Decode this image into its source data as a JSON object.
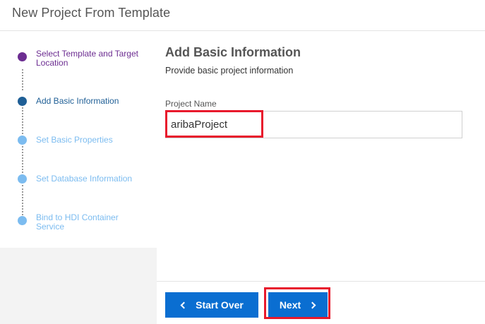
{
  "window": {
    "title": "New Project From Template"
  },
  "steps": [
    {
      "label": "Select Template and Target Location",
      "state": "completed"
    },
    {
      "label": "Add Basic Information",
      "state": "current"
    },
    {
      "label": "Set Basic Properties",
      "state": "upcoming"
    },
    {
      "label": "Set Database Information",
      "state": "upcoming"
    },
    {
      "label": "Bind to HDI Container Service",
      "state": "upcoming"
    }
  ],
  "main": {
    "title": "Add Basic Information",
    "subtitle": "Provide basic project information",
    "project_name_label": "Project Name",
    "project_name_value": "aribaProject"
  },
  "footer": {
    "start_over_label": "Start Over",
    "next_label": "Next"
  },
  "colors": {
    "step_completed": "#6c2d91",
    "step_current": "#1f5f96",
    "step_upcoming": "#7cbcf0",
    "primary_button": "#0a6ed1",
    "highlight": "#e8192c"
  },
  "icons": {
    "start_over": "chevron-left-icon",
    "next": "chevron-right-icon"
  }
}
